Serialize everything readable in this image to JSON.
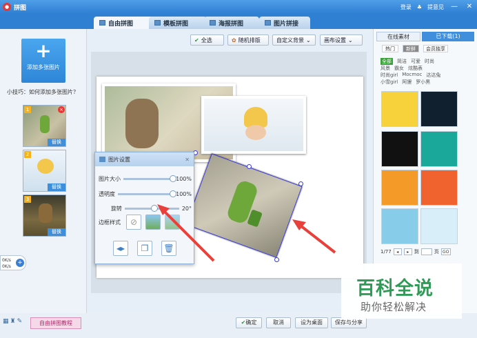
{
  "window": {
    "title": "拼图",
    "login": "登录",
    "feedback": "提意见"
  },
  "tabs": [
    {
      "label": "自由拼图"
    },
    {
      "label": "模板拼图"
    },
    {
      "label": "海报拼图"
    },
    {
      "label": "图片拼接"
    }
  ],
  "left": {
    "add_label": "添加多张图片",
    "tip": "小技巧：如何添加多张图片？",
    "thumbs": [
      {
        "num": "1",
        "replace": "替换"
      },
      {
        "num": "2",
        "replace": "替换"
      },
      {
        "num": "3",
        "replace": "替换"
      }
    ],
    "speed_up": "0K/s",
    "speed_down": "0K/s",
    "tutorial": "自由拼图教程"
  },
  "toolbar": {
    "select_all": "全选",
    "random": "随机排版",
    "custom_bg": "自定义背景",
    "canvas_settings": "画布设置"
  },
  "dialog": {
    "title": "图片设置",
    "size_label": "图片大小",
    "size_value": "100%",
    "size_level": 1.0,
    "opacity_label": "透明度",
    "opacity_value": "100%",
    "opacity_level": 1.0,
    "rotate_label": "旋转",
    "rotate_value": "20°",
    "rotate_level": 0.55,
    "border_label": "边框样式"
  },
  "right": {
    "tab_online": "在线素材",
    "tab_downloaded": "已下载(1)",
    "chip_hot": "热门",
    "chip_new": "新鲜",
    "chip_member": "会员独享",
    "tags_row1": [
      "全部",
      "简洁",
      "可爱",
      "时尚"
    ],
    "tags_row2": [
      "风景",
      "霸女",
      "炫酷表"
    ],
    "tags_row3": [
      "时尚girl",
      "Mocmoc",
      "达达兔"
    ],
    "tags_row4": [
      "小雪girl",
      "阿狸",
      "罗小黑"
    ],
    "page": "1/77",
    "goto": "到",
    "page_unit": "页",
    "go": "GO"
  },
  "bottom": {
    "confirm": "确定",
    "cancel": "取消",
    "set_desktop": "设为桌面",
    "save_share": "保存与分享"
  },
  "watermark": {
    "line1": "百科全说",
    "line2": "助你轻松解决"
  },
  "colors": {
    "accent": "#2f7fd3",
    "arrow": "#e8413b",
    "watermark_green": "#2f9b57"
  }
}
